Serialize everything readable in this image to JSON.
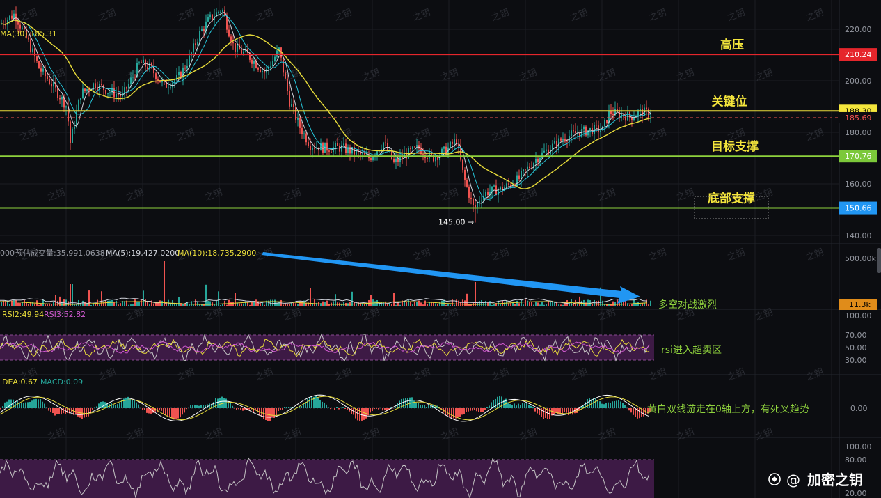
{
  "price_panel": {
    "ma30_label": "MA(30):185.31",
    "y_ticks": [
      "220.00",
      "200.00",
      "180.00",
      "160.00",
      "140.00"
    ],
    "levels": [
      {
        "key": "high",
        "value": 210.24,
        "label": "210.24",
        "zone": "高压",
        "line": "#e5262c",
        "tag": "#e5262c",
        "tag_text": "#ffffff"
      },
      {
        "key": "key",
        "value": 188.3,
        "label": "188.30",
        "zone": "关键位",
        "line": "#e8dc3a",
        "tag": "#f5e63c",
        "tag_text": "#000000"
      },
      {
        "key": "target",
        "value": 170.76,
        "label": "170.76",
        "zone": "目标支撑",
        "line": "#8ed13d",
        "tag": "#7cc83a",
        "tag_text": "#ffffff"
      },
      {
        "key": "bottom",
        "value": 150.66,
        "label": "150.66",
        "zone": "底部支撑",
        "line": "#8ed13d",
        "tag": "#2196f3",
        "tag_text": "#ffffff"
      }
    ],
    "last_price": {
      "value": 185.69,
      "label": "185.69"
    },
    "low_marker": {
      "value": 145.0,
      "label": "145.00 →"
    },
    "y_range": [
      135,
      230
    ]
  },
  "volume_panel": {
    "labels": [
      {
        "text": "000",
        "color": "#9598a1"
      },
      {
        "text": "预估成交量:35,991.0638",
        "color": "#9598a1"
      },
      {
        "text": "MA(5):19,427.0200",
        "color": "#d1d4dc"
      },
      {
        "text": "MA(10):18,735.2900",
        "color": "#e8dc3a"
      }
    ],
    "tick_top": "500.00k",
    "current_tag": "11.3k",
    "annotation": "多空对战激烈",
    "arrow_color": "#2196f3"
  },
  "rsi_panel": {
    "rsi2_label": "RSI2:49.94",
    "rsi3_label": "RSI3:52.82",
    "y_ticks": [
      "100.00",
      "70.00",
      "50.00",
      "30.00"
    ],
    "annotation": "rsi进入超卖区"
  },
  "macd_panel": {
    "dea_label": "DEA:0.67",
    "macd_label": "MACD:0.09",
    "y_ticks": [
      "0.00"
    ],
    "annotation": "黄白双线游走在0轴上方，有死叉趋势"
  },
  "stoch_panel": {
    "y_ticks": [
      "100.00",
      "80.00",
      "20.00"
    ]
  },
  "watermark": "之钥",
  "brand": {
    "name": "加密之钥",
    "at": "@"
  },
  "colors": {
    "up": "#26a69a",
    "down": "#ef5350",
    "ma_yellow": "#e8dc3a",
    "ma_white": "#d1d4dc",
    "panel_purple": "#3d1a45",
    "annotation_green": "#8ed13d",
    "zone_yellow": "#f5e63c"
  }
}
